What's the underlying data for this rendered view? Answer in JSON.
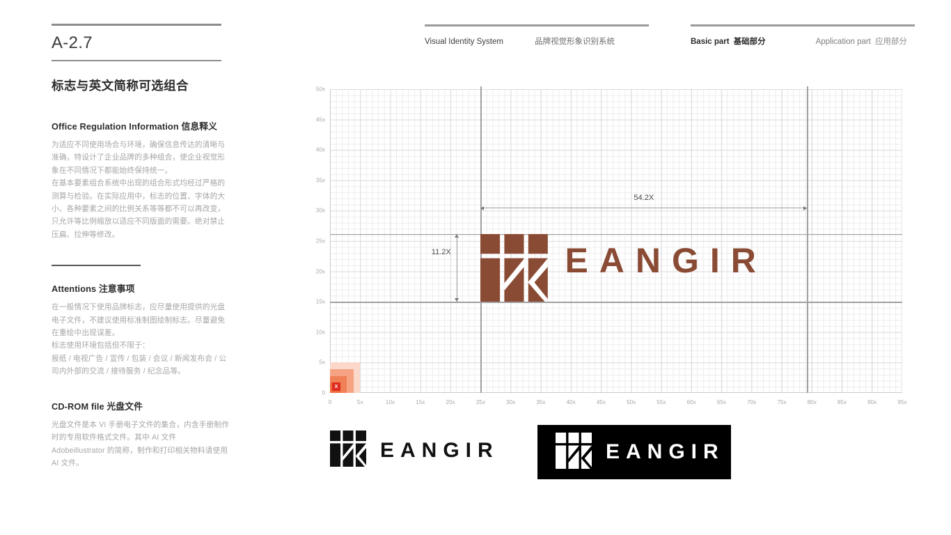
{
  "document": {
    "page_code": "A-2.7",
    "section_title": "标志与英文简称可选组合"
  },
  "header": {
    "left_en": "Visual Identity System",
    "left_cn": "品牌视觉形象识别系统",
    "basic_en": "Basic part",
    "basic_cn": "基础部分",
    "application_en": "Application part",
    "application_cn": "应用部分"
  },
  "sections": [
    {
      "heading_en": "Office Regulation Information",
      "heading_cn": "信息释义",
      "paragraphs": [
        "为适应不同使用场合与环境，确保信息传达的清晰与准确，特设计了企业品牌的多种组合，使企业视觉形象在不同情况下都能始终保持统一。",
        "在基本要素组合系统中出现的组合形式均经过严格的测算与检验。在实际应用中，标志的位置、字体的大小、各种要素之间的比例关系等等都不可以再改变，只允许等比例缩放以适应不同版面的需要。绝对禁止压扁、拉伸等修改。"
      ]
    },
    {
      "heading_en": "Attentions",
      "heading_cn": "注意事项",
      "paragraphs": [
        "在一般情况下使用品牌标志，应尽量使用提供的光盘电子文件，不建议使用标准制图绘制标志。尽量避免在重绘中出现误差。",
        "标志使用环境包括但不限于：",
        "报纸 / 电视广告 / 宣传 / 包装 / 会议 / 新闻发布会 / 公司内外部的交流 / 接待服务 / 纪念品等。"
      ]
    },
    {
      "heading_en": "CD-ROM file",
      "heading_cn": "光盘文件",
      "paragraphs": [
        "光盘文件是本 VI 手册电子文件的集合，内含手册制作时的专用软件格式文件。其中 AI 文件 Adobeillustrator 的简称，制作和打印相关物料请使用 AI 文件。"
      ]
    }
  ],
  "chart_data": {
    "type": "grid-diagram",
    "title": "Logo and English abbreviation lockup construction grid",
    "xlabel": "",
    "ylabel": "",
    "xlim": [
      0,
      95
    ],
    "ylim": [
      0,
      50
    ],
    "x_tick_step": 5,
    "y_tick_step": 5,
    "x_ticks": [
      "0",
      "5x",
      "10x",
      "15x",
      "20x",
      "25x",
      "30x",
      "35x",
      "40x",
      "45x",
      "50x",
      "55x",
      "60x",
      "65x",
      "70x",
      "75x",
      "80x",
      "85x",
      "90x",
      "95x"
    ],
    "y_ticks": [
      "0",
      "5x",
      "10x",
      "15x",
      "20x",
      "25x",
      "30x",
      "35x",
      "40x",
      "45x",
      "50x"
    ],
    "grid": "on",
    "grid_minor_step": 1,
    "grid_major_step": 5,
    "legend": "none",
    "guides": [
      {
        "orientation": "vertical",
        "value": 25.0,
        "label": "logo-left-guide"
      },
      {
        "orientation": "vertical",
        "value": 79.2,
        "label": "wordmark-right-guide"
      },
      {
        "orientation": "horizontal",
        "value": 26.2,
        "label": "logo-top-guide"
      },
      {
        "orientation": "horizontal",
        "value": 15.0,
        "label": "logo-baseline-guide"
      }
    ],
    "elements": [
      {
        "name": "logo-mark",
        "x": 25.0,
        "y": 15.0,
        "width": 11.2,
        "height": 11.2,
        "color": "#8a4b34"
      },
      {
        "name": "wordmark",
        "text": "EANGIR",
        "x": 39.0,
        "y": 17.5,
        "height": 6.5,
        "color": "#8a4b34"
      },
      {
        "name": "clear-space-swatch",
        "x": 0.0,
        "y": 0.0,
        "width": 5.0,
        "height": 5.0
      }
    ],
    "annotations": [
      {
        "name": "total-width",
        "text": "54.2X",
        "from_x": 25.0,
        "to_x": 79.2,
        "at_y": 30.5
      },
      {
        "name": "logo-height",
        "text": "11.2X",
        "from_y": 15.0,
        "to_y": 26.2,
        "at_x": 21.0
      }
    ]
  },
  "origin_marker": {
    "badge_text": "X",
    "badge_color": "#e02b20",
    "swatch_colors": [
      "#fbd8c9",
      "#f5a382",
      "#f08055",
      "#ec6d3f"
    ]
  },
  "brand": {
    "wordmark": "EANGIR",
    "mark_color": "#8a4b34",
    "lockup_light_word": "EANGIR",
    "lockup_dark_word": "EANGIR",
    "lockup_light_color": "#111111",
    "lockup_dark_bg": "#000000",
    "lockup_dark_fg": "#ffffff"
  }
}
